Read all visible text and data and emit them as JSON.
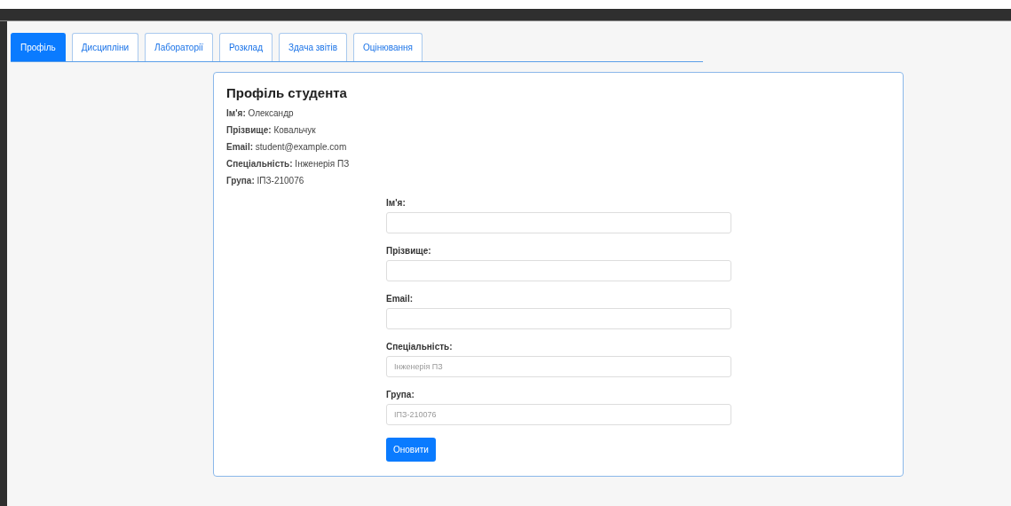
{
  "tabs": [
    {
      "label": "Профіль",
      "selected": true
    },
    {
      "label": "Дисципліни",
      "selected": false
    },
    {
      "label": "Лабораторії",
      "selected": false
    },
    {
      "label": "Розклад",
      "selected": false
    },
    {
      "label": "Здача звітів",
      "selected": false
    },
    {
      "label": "Оцінювання",
      "selected": false
    }
  ],
  "profile": {
    "title": "Профіль студента",
    "info": [
      {
        "label": "Ім'я:",
        "value": "Олександр"
      },
      {
        "label": "Прізвище:",
        "value": "Ковальчук"
      },
      {
        "label": "Email:",
        "value": "student@example.com"
      },
      {
        "label": "Спеціальність:",
        "value": "Інженерія ПЗ"
      },
      {
        "label": "Група:",
        "value": "ІПЗ-210076"
      }
    ]
  },
  "form": {
    "fields": [
      {
        "label": "Ім'я:"
      },
      {
        "label": "Прізвище:"
      },
      {
        "label": "Email:"
      },
      {
        "label": "Спеціальність:",
        "placeholder": "Інженерія ПЗ"
      },
      {
        "label": "Група:",
        "placeholder": "ІПЗ-210076"
      }
    ],
    "submit": "Оновити"
  }
}
